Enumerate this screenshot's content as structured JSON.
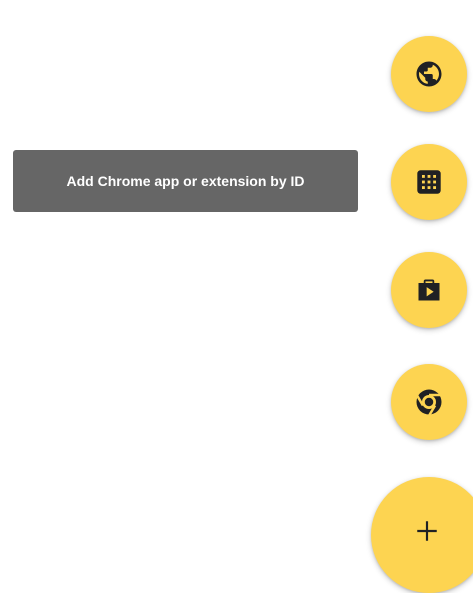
{
  "speed_dial": {
    "tooltip_text": "Add Chrome app or extension by ID",
    "actions": [
      {
        "icon": "globe-icon",
        "name": "web-app-action"
      },
      {
        "icon": "app-grid-icon",
        "name": "add-by-id-action"
      },
      {
        "icon": "play-store-bag-icon",
        "name": "play-store-action"
      },
      {
        "icon": "chrome-icon",
        "name": "chrome-web-store-action"
      }
    ],
    "main": {
      "icon": "plus-icon",
      "label": "+"
    }
  },
  "colors": {
    "fab": "#fdd451",
    "icon": "#202124",
    "tooltip_bg": "#666666",
    "tooltip_text": "#ffffff",
    "background": "#ffffff"
  }
}
